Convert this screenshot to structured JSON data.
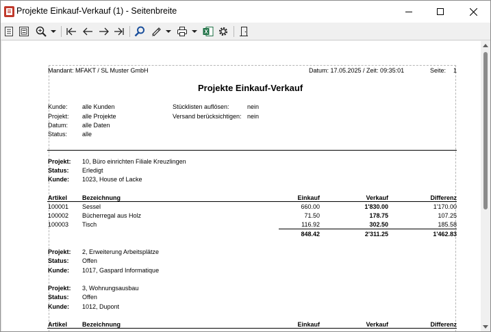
{
  "window": {
    "title": "Projekte Einkauf-Verkauf (1) - Seitenbreite"
  },
  "toolbar": {
    "buttons": [
      "page-view-icon",
      "two-page-icon",
      "zoom-icon",
      "dropdown-icon",
      "first-page-icon",
      "prev-page-icon",
      "next-page-icon",
      "last-page-icon",
      "search-icon",
      "edit-icon",
      "dropdown-icon",
      "print-icon",
      "dropdown-icon",
      "excel-icon",
      "settings-icon",
      "exit-icon"
    ]
  },
  "report": {
    "mandant": "Mandant: MFAKT / SL Muster GmbH",
    "datum": "Datum: 17.05.2025 / Zeit: 09:35:01",
    "seite": "Seite:",
    "seite_num": "1",
    "title": "Projekte Einkauf-Verkauf",
    "filters": {
      "kunde_label": "Kunde:",
      "kunde_value": "alle Kunden",
      "projekt_label": "Projekt:",
      "projekt_value": "alle Projekte",
      "datum_label": "Datum:",
      "datum_value": "alle Daten",
      "status_label": "Status:",
      "status_value": "alle",
      "stueck_label": "Stücklisten auflösen:",
      "stueck_value": "nein",
      "versand_label": "Versand berücksichtigen:",
      "versand_value": "nein"
    },
    "labels": {
      "projekt": "Projekt:",
      "status": "Status:",
      "kunde": "Kunde:"
    },
    "columns": {
      "artikel": "Artikel",
      "bezeichnung": "Bezeichnung",
      "einkauf": "Einkauf",
      "verkauf": "Verkauf",
      "differenz": "Differenz"
    },
    "projects": [
      {
        "projekt": "10, Büro einrichten Filiale Kreuzlingen",
        "status": "Erledigt",
        "kunde": "1023, House of Lacke",
        "rows": [
          {
            "artikel": "100001",
            "bezeichnung": "Sessel",
            "einkauf": "660.00",
            "verkauf": "1'830.00",
            "differenz": "1'170.00"
          },
          {
            "artikel": "100002",
            "bezeichnung": "Bücherregal aus Holz",
            "einkauf": "71.50",
            "verkauf": "178.75",
            "differenz": "107.25"
          },
          {
            "artikel": "100003",
            "bezeichnung": "Tisch",
            "einkauf": "116.92",
            "verkauf": "302.50",
            "differenz": "185.58"
          }
        ],
        "totals": {
          "einkauf": "848.42",
          "verkauf": "2'311.25",
          "differenz": "1'462.83"
        }
      },
      {
        "projekt": "2, Erweiterung Arbeitsplätze",
        "status": "Offen",
        "kunde": "1017, Gaspard Informatique"
      },
      {
        "projekt": "3, Wohnungsausbau",
        "status": "Offen",
        "kunde": "1012, Dupont"
      }
    ]
  }
}
